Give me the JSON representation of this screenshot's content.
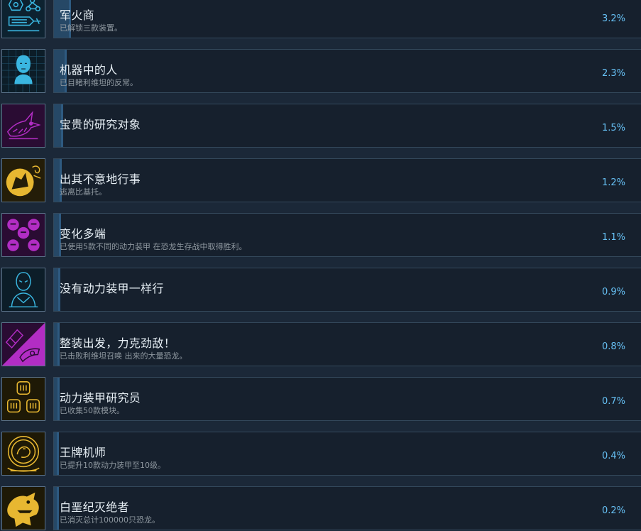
{
  "colors": {
    "background": "#1b2838",
    "panel": "#16202d",
    "panel_border": "#34495c",
    "progress_fill": "#264866",
    "title_text": "#e6eef4",
    "desc_text": "#8f98a0",
    "percent_text": "#67c1f5",
    "icon_cyan": "#3ab6e0",
    "icon_magenta": "#b22dc4",
    "icon_gold": "#e7b731"
  },
  "achievements": [
    {
      "title": "军火商",
      "desc": "已解锁三款装置。",
      "percent": "3.2%",
      "fraction": 0.032,
      "icon": "arms-dealer-icon",
      "icon_color": "cyan"
    },
    {
      "title": "机器中的人",
      "desc": "已目睹利维坦的反常。",
      "percent": "2.3%",
      "fraction": 0.023,
      "icon": "ghost-in-machine-icon",
      "icon_color": "cyan"
    },
    {
      "title": "宝贵的研究对象",
      "desc": "",
      "percent": "1.5%",
      "fraction": 0.015,
      "icon": "precious-specimen-icon",
      "icon_color": "magenta"
    },
    {
      "title": "出其不意地行事",
      "desc": "逃离比基托。",
      "percent": "1.2%",
      "fraction": 0.012,
      "icon": "surprise-escape-icon",
      "icon_color": "gold"
    },
    {
      "title": "变化多端",
      "desc": "已使用5款不同的动力装甲 在恐龙生存战中取得胜利。",
      "percent": "1.1%",
      "fraction": 0.011,
      "icon": "many-faces-icon",
      "icon_color": "magenta"
    },
    {
      "title": "没有动力装甲一样行",
      "desc": "",
      "percent": "0.9%",
      "fraction": 0.009,
      "icon": "no-suit-icon",
      "icon_color": "cyan"
    },
    {
      "title": "整装出发，力克劲敌！",
      "desc": "已击败利维坦召唤 出来的大量恐龙。",
      "percent": "0.8%",
      "fraction": 0.008,
      "icon": "suit-up-icon",
      "icon_color": "magenta"
    },
    {
      "title": "动力装甲研究员",
      "desc": "已收集50款模块。",
      "percent": "0.7%",
      "fraction": 0.007,
      "icon": "exosuit-researcher-icon",
      "icon_color": "gold"
    },
    {
      "title": "王牌机师",
      "desc": "已提升10款动力装甲至10级。",
      "percent": "0.4%",
      "fraction": 0.004,
      "icon": "ace-pilot-icon",
      "icon_color": "gold"
    },
    {
      "title": "白垩纪灭绝者",
      "desc": "已消灭总计100000只恐龙。",
      "percent": "0.2%",
      "fraction": 0.002,
      "icon": "cretaceous-exterminator-icon",
      "icon_color": "gold"
    }
  ]
}
